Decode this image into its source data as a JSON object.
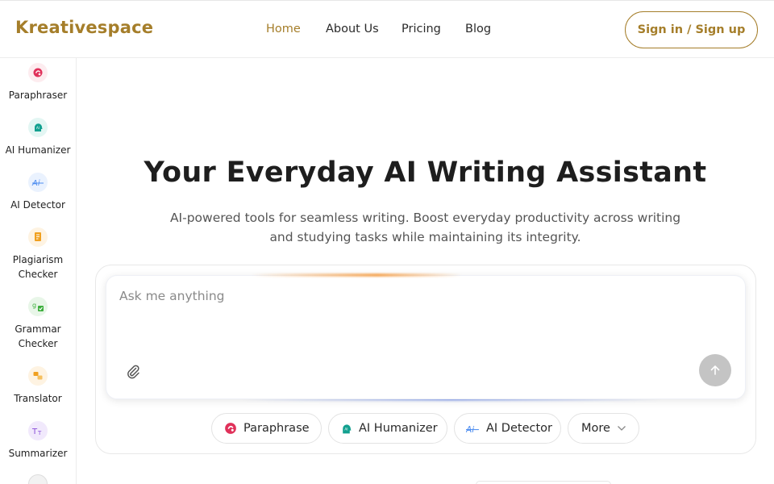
{
  "brand": {
    "name": "Kreativespace",
    "color": "#a57e2a"
  },
  "nav": {
    "items": [
      {
        "label": "Home",
        "active": true
      },
      {
        "label": "About Us",
        "active": false
      },
      {
        "label": "Pricing",
        "active": false
      },
      {
        "label": "Blog",
        "active": false
      }
    ],
    "signin_label": "Sign in / Sign up"
  },
  "sidebar": {
    "items": [
      {
        "label": "Paraphraser",
        "icon": "paraphraser-icon",
        "color": "#e0315a"
      },
      {
        "label": "AI Humanizer",
        "icon": "humanizer-head-icon",
        "color": "#12a08f"
      },
      {
        "label": "AI Detector",
        "icon": "ai-detector-icon",
        "color": "#4f8ef0"
      },
      {
        "label": "Plagiarism\nChecker",
        "icon": "document-icon",
        "color": "#f0a020"
      },
      {
        "label": "Grammar\nChecker",
        "icon": "grammar-check-icon",
        "color": "#3cae3c"
      },
      {
        "label": "Translator",
        "icon": "translate-icon",
        "color": "#f0a020"
      },
      {
        "label": "Summarizer",
        "icon": "summarizer-icon",
        "color": "#8a4fd8"
      }
    ]
  },
  "hero": {
    "title": "Your Everyday AI Writing Assistant",
    "subtitle": "AI-powered tools for seamless writing. Boost everyday productivity across writing and studying tasks while maintaining its integrity."
  },
  "prompt": {
    "placeholder": "Ask me anything",
    "value": ""
  },
  "chips": [
    {
      "label": "Paraphrase",
      "icon": "paraphraser-icon"
    },
    {
      "label": "AI Humanizer",
      "icon": "humanizer-head-icon"
    },
    {
      "label": "AI Detector",
      "icon": "ai-detector-icon"
    },
    {
      "label": "More",
      "icon": "chevron-down-icon"
    }
  ]
}
